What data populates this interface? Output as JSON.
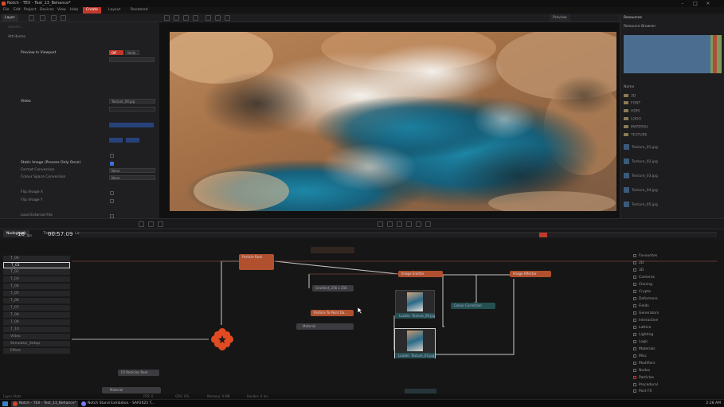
{
  "window": {
    "title": "Notch - TEX - Test_13_Behance*"
  },
  "menu": {
    "items": [
      "File",
      "Edit",
      "Project",
      "Devices",
      "View",
      "Help"
    ],
    "modes": [
      "Create",
      "Layout",
      "Rendered"
    ]
  },
  "toolbar": {
    "tabs": [
      "Layer",
      "Preview",
      "Resources",
      "Nodes"
    ]
  },
  "left_panel": {
    "section": "Attributes",
    "rows": [
      {
        "label": "Preview In Viewport",
        "bright": true
      },
      {
        "label": "Video",
        "bright": true
      },
      {
        "label": "Static Image (Process Only Once)",
        "bright": true
      },
      {
        "label": "Format Conversion",
        "bright": false
      },
      {
        "label": "Colour Space Conversion",
        "bright": false
      },
      {
        "label": "Flip Image X",
        "bright": false
      },
      {
        "label": "Flip Image Y",
        "bright": false
      },
      {
        "label": "Load External File",
        "bright": false
      }
    ],
    "preview_toggle": [
      "Off",
      "Node"
    ],
    "video_value": "Texture_09.jpg",
    "format_value": "None",
    "colour_value": "None",
    "footer": "Video"
  },
  "viewport": {
    "label": "Preview"
  },
  "right_panel": {
    "title": "Resources",
    "subtitle": "Resource Browser",
    "list_header": "Name",
    "folders": [
      "3D",
      "FONT",
      "HDRI",
      "LOGO",
      "MATERIAL",
      "TEXTURE"
    ],
    "files": [
      "Texture_01.jpg",
      "Texture_02.jpg",
      "Texture_03.jpg",
      "Texture_04.jpg",
      "Texture_05.jpg"
    ]
  },
  "graph": {
    "tabs": [
      "Nodegraph",
      "Timeline",
      "Layers"
    ],
    "fps": "16",
    "fps_unit": "fps",
    "timecode": "00:57:09",
    "layers": [
      "T_06",
      "T_01",
      "T_02",
      "T_03",
      "T_04",
      "T_05",
      "T_06",
      "T_07",
      "T_08",
      "T_09",
      "T_10",
      "Video",
      "Simulator_Setup",
      "Effect"
    ],
    "selected_layer_index": 1,
    "nodes": {
      "particle_root": "Particle Root",
      "gradient": "Gradient_256 x 256",
      "image_emitter": "Image Emitter",
      "image_affector": "Image Affector",
      "particle_to_point": "Particle To Point Da...",
      "material": "Material",
      "colour_correction": "Colour Correction",
      "texture_a": "Loader: Texture_09.jpg",
      "texture_b": "Loader: Texture_03.jpg",
      "fx_processor": "FX Particles Root",
      "material2": "Material"
    },
    "categories": [
      "Favourites",
      "2D",
      "3D",
      "Cameras",
      "Cloning",
      "Crypto",
      "Deformers",
      "Fields",
      "Generators",
      "Interactive",
      "Lattice",
      "Lighting",
      "Logic",
      "Materials",
      "Misc",
      "Modifiers",
      "Nodes",
      "Particles",
      "Procedural",
      "Post FX"
    ]
  },
  "statusbar": {
    "items": [
      "Layer Stats",
      "FPS: 0",
      "GPU: 0%",
      "Memory: 0 MB",
      "Render: 0 ms"
    ]
  },
  "taskbar": {
    "items": [
      "Notch - TEX - Test_13_Behance*",
      "Notch Stand Exhibition - SAP2025 T..."
    ],
    "clock": "2:28 AM"
  },
  "colors": {
    "accent": "#c0392b",
    "node_orange": "#b0502f",
    "selection": "#3d6fd6"
  }
}
